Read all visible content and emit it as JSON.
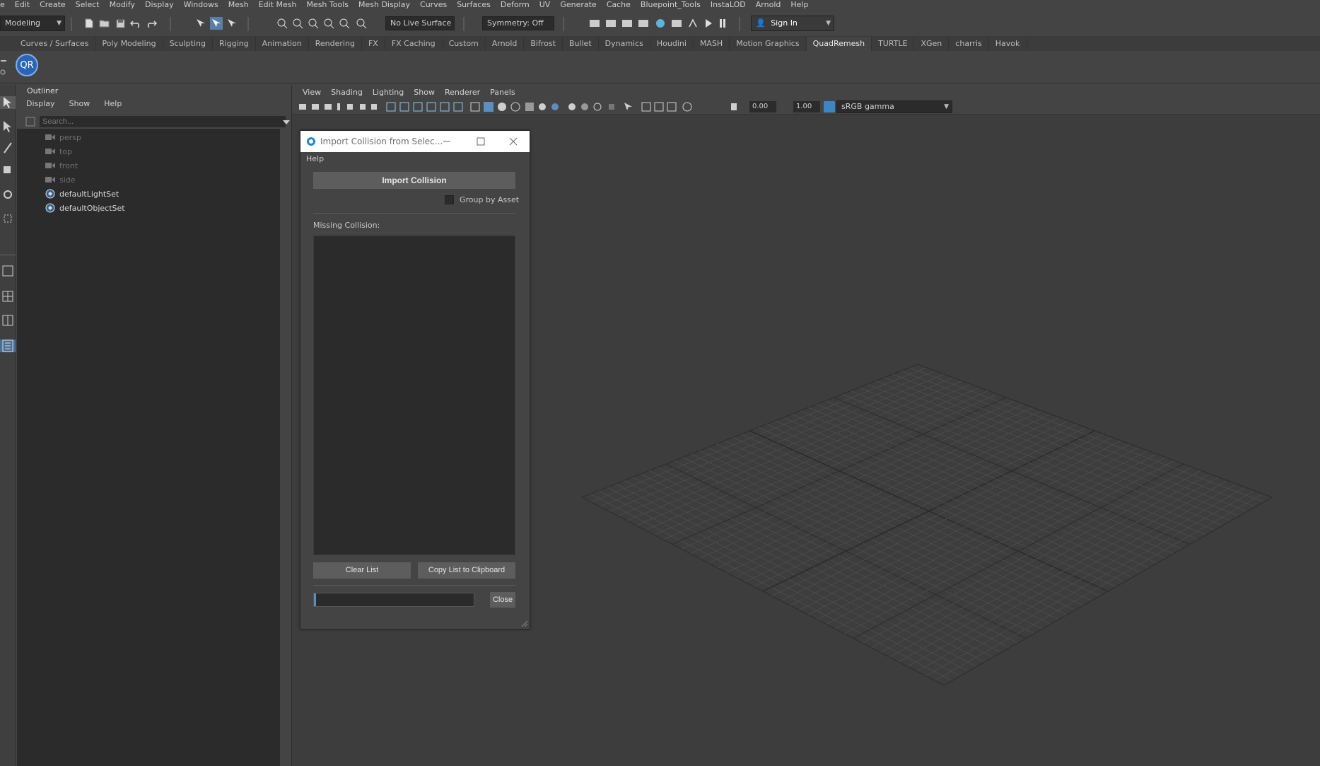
{
  "menubar": [
    "e",
    "Edit",
    "Create",
    "Select",
    "Modify",
    "Display",
    "Windows",
    "Mesh",
    "Edit Mesh",
    "Mesh Tools",
    "Mesh Display",
    "Curves",
    "Surfaces",
    "Deform",
    "UV",
    "Generate",
    "Cache",
    "Bluepoint_Tools",
    "InstaLOD",
    "Arnold",
    "Help"
  ],
  "statusline": {
    "workspace": "Modeling",
    "live_surface": "No Live Surface",
    "symmetry": "Symmetry: Off",
    "signin": "Sign In"
  },
  "shelf_tabs": [
    "Curves / Surfaces",
    "Poly Modeling",
    "Sculpting",
    "Rigging",
    "Animation",
    "Rendering",
    "FX",
    "FX Caching",
    "Custom",
    "Arnold",
    "Bifrost",
    "Bullet",
    "Dynamics",
    "Houdini",
    "MASH",
    "Motion Graphics",
    "QuadRemesh",
    "TURTLE",
    "XGen",
    "charris",
    "Havok"
  ],
  "active_shelf_tab": "QuadRemesh",
  "shelf": {
    "qr_label": "QR"
  },
  "outliner": {
    "title": "Outliner",
    "menu": [
      "Display",
      "Show",
      "Help"
    ],
    "search_placeholder": "Search...",
    "items": [
      {
        "label": "persp",
        "type": "camera",
        "dim": true
      },
      {
        "label": "top",
        "type": "camera",
        "dim": true
      },
      {
        "label": "front",
        "type": "camera",
        "dim": true
      },
      {
        "label": "side",
        "type": "camera",
        "dim": true
      },
      {
        "label": "defaultLightSet",
        "type": "set",
        "dim": false
      },
      {
        "label": "defaultObjectSet",
        "type": "set",
        "dim": false
      }
    ]
  },
  "viewport": {
    "menu": [
      "View",
      "Shading",
      "Lighting",
      "Show",
      "Renderer",
      "Panels"
    ],
    "exposure": "0.00",
    "gamma": "1.00",
    "color_space": "sRGB gamma"
  },
  "dialog": {
    "title": "Import Collision from Selec...",
    "help": "Help",
    "import_button": "Import Collision",
    "group_by_asset": "Group by Asset",
    "missing_label": "Missing Collision:",
    "clear_button": "Clear List",
    "copy_button": "Copy List to Clipboard",
    "close_button": "Close",
    "progress": 0.01
  },
  "colors": {
    "background": "#444444",
    "panel_dark": "#2b2b2b",
    "accent": "#5b8fbf",
    "qr_badge": "#2a64b8"
  }
}
